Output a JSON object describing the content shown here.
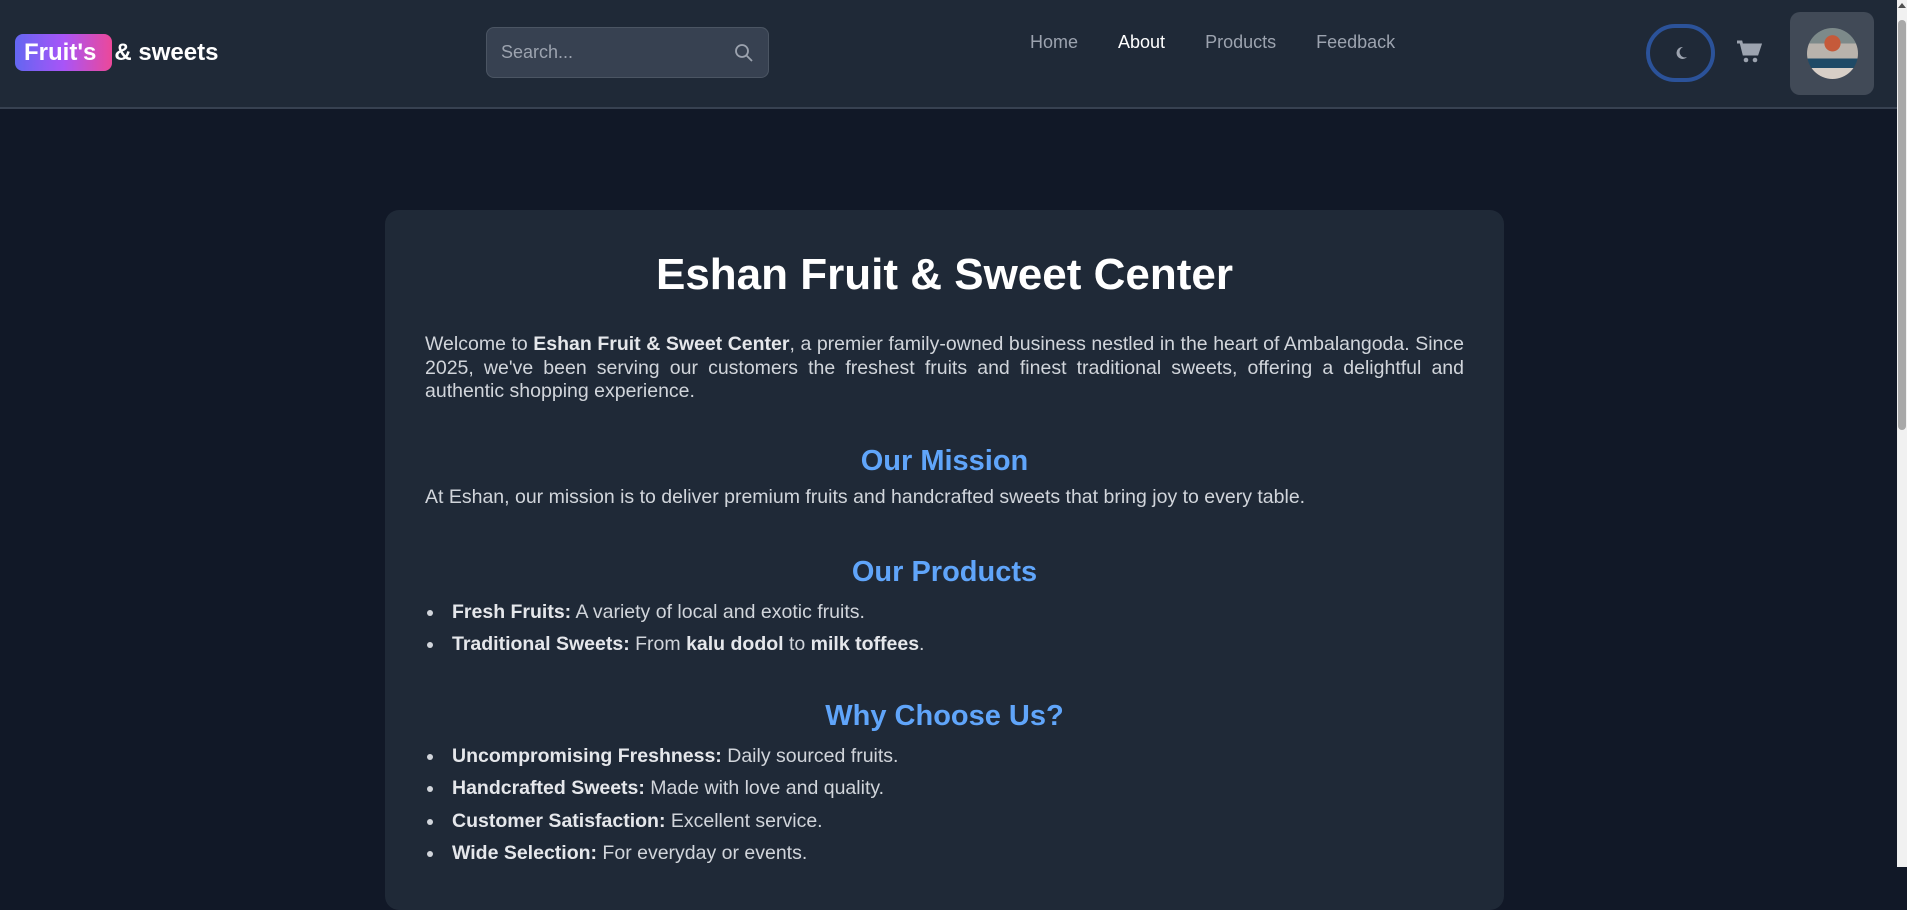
{
  "header": {
    "logo_badge": "Fruit's",
    "logo_rest": "& sweets",
    "search_placeholder": "Search...",
    "nav": [
      {
        "label": "Home"
      },
      {
        "label": "About"
      },
      {
        "label": "Products"
      },
      {
        "label": "Feedback"
      }
    ]
  },
  "main": {
    "title": "Eshan Fruit & Sweet Center",
    "intro": {
      "pre": "Welcome to ",
      "bold": "Eshan Fruit & Sweet Center",
      "post": ", a premier family-owned business nestled in the heart of Ambalangoda. Since 2025, we've been serving our customers the freshest fruits and finest traditional sweets, offering a delightful and authentic shopping experience."
    },
    "mission_heading": "Our Mission",
    "mission_text": "At Eshan, our mission is to deliver premium fruits and handcrafted sweets that bring joy to every table.",
    "products_heading": "Our Products",
    "products": [
      {
        "label": "Fresh Fruits:",
        "text": " A variety of local and exotic fruits."
      },
      {
        "label": "Traditional Sweets:",
        "text": " From ",
        "b1": "kalu dodol",
        "mid": " to ",
        "b2": "milk toffees",
        "end": "."
      }
    ],
    "why_heading": "Why Choose Us?",
    "why": [
      {
        "label": "Uncompromising Freshness:",
        "text": " Daily sourced fruits."
      },
      {
        "label": "Handcrafted Sweets:",
        "text": " Made with love and quality."
      },
      {
        "label": "Customer Satisfaction:",
        "text": " Excellent service."
      },
      {
        "label": "Wide Selection:",
        "text": " For everyday or events."
      }
    ]
  }
}
